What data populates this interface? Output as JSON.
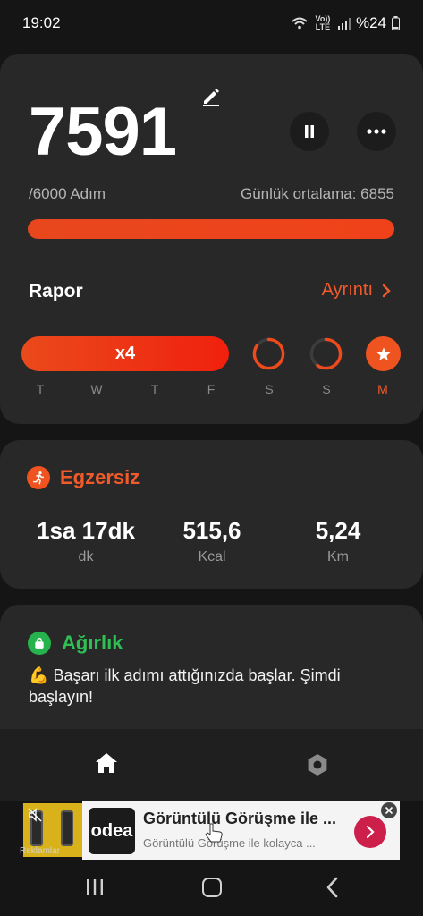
{
  "status_bar": {
    "time": "19:02",
    "network_label": "Vo)) LTE",
    "battery": "%24"
  },
  "steps": {
    "value": "7591",
    "goal_text": "/6000 Adım",
    "average_text": "Günlük ortalama: 6855",
    "progress_fraction": 1.0
  },
  "report": {
    "title": "Rapor",
    "link_label": "Ayrıntı",
    "streak_label": "x4",
    "days": [
      "T",
      "W",
      "T",
      "F",
      "S",
      "S",
      "M"
    ],
    "active_day_index": 6,
    "ring_fractions": [
      0.85,
      0.6
    ]
  },
  "exercise": {
    "title": "Egzersiz",
    "stats": [
      {
        "value": "1sa 17dk",
        "unit": "dk"
      },
      {
        "value": "515,6",
        "unit": "Kcal"
      },
      {
        "value": "5,24",
        "unit": "Km"
      }
    ]
  },
  "weight": {
    "title": "Ağırlık",
    "emoji": "💪",
    "message": "Başarı ilk adımı attığınızda başlar. Şimdi başlayın!"
  },
  "ad": {
    "label": "Reklamlar",
    "logo_text": "odea",
    "title": "Görüntülü Görüşme ile ...",
    "subtitle": "Görüntülü Görüşme ile kolayca ..."
  },
  "colors": {
    "accent": "#f25a2a",
    "green": "#2fbf55",
    "card": "#282828",
    "background": "#151515"
  }
}
